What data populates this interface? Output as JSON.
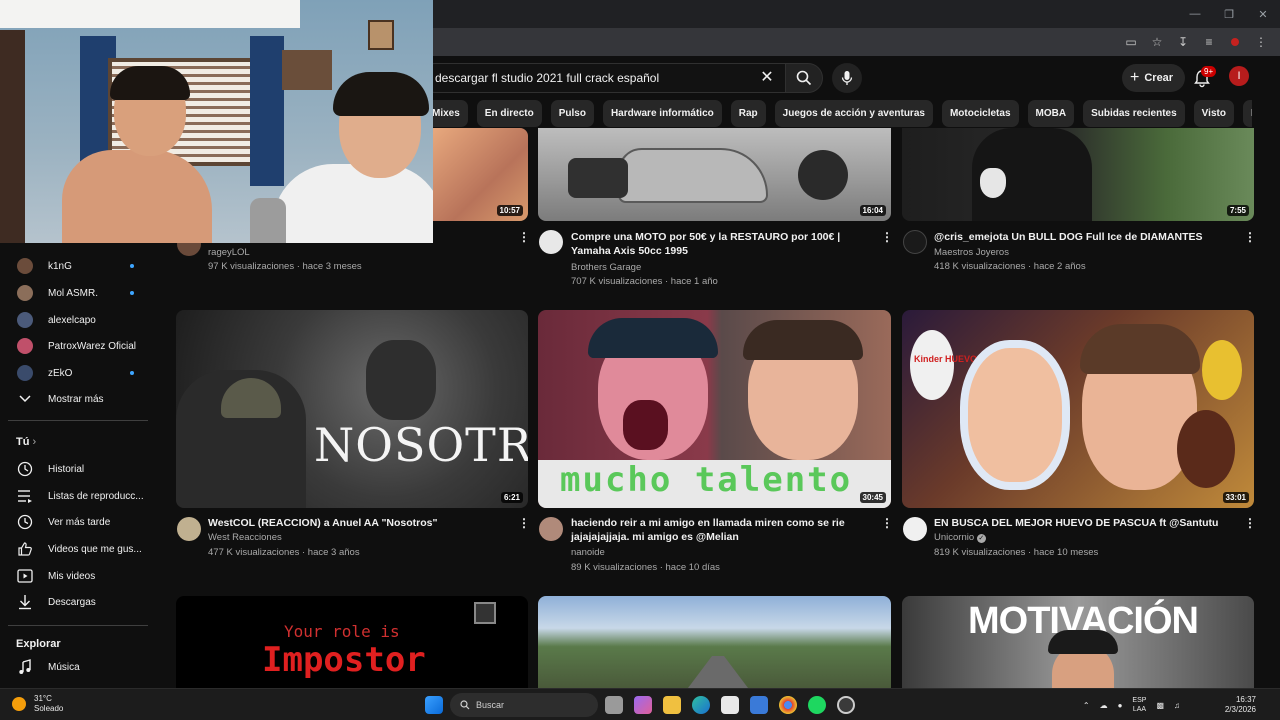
{
  "search": {
    "query": "descargar fl studio 2021 full crack español"
  },
  "header": {
    "create_label": "Crear",
    "notif_badge": "9+",
    "avatar_letter": "I"
  },
  "chips": [
    "Mixes",
    "En directo",
    "Pulso",
    "Hardware informático",
    "Rap",
    "Juegos de acción y aventuras",
    "Motocicletas",
    "MOBA",
    "Subidas recientes",
    "Visto",
    "Novedad para ti"
  ],
  "sidebar": {
    "subscriptions": [
      {
        "label": "k1nG",
        "color": "#6b4c3b"
      },
      {
        "label": "Mol ASMR.",
        "color": "#8b6e5a"
      },
      {
        "label": "alexelcapo",
        "color": "#4b5a7a"
      },
      {
        "label": "PatroxWarez Oficial",
        "color": "#c0506a"
      },
      {
        "label": "zEkO",
        "color": "#3a4b6b"
      }
    ],
    "show_more": "Mostrar más",
    "you_heading": "Tú",
    "you_items": [
      "Historial",
      "Listas de reproducc...",
      "Ver más tarde",
      "Videos que me gus...",
      "Mis videos",
      "Descargas"
    ],
    "explore_heading": "Explorar",
    "explore_items": [
      "Música"
    ]
  },
  "videos_row1": [
    {
      "title": "",
      "channel": "rageyLOL",
      "meta": "97 K visualizaciones · hace 3 meses",
      "duration": "10:57"
    },
    {
      "title": "Compre una MOTO por 50€ y la RESTAURO por 100€ | Yamaha Axis 50cc 1995",
      "channel": "Brothers Garage",
      "meta": "707 K visualizaciones · hace 1 año",
      "duration": "16:04"
    },
    {
      "title": "@cris_emejota  Un BULL DOG Full Ice de DIAMANTES",
      "channel": "Maestros Joyeros",
      "meta": "418 K visualizaciones · hace 2 años",
      "duration": "7:55"
    }
  ],
  "videos_row2": [
    {
      "title": "WestCOL (REACCION) a Anuel AA \"Nosotros\"",
      "channel": "West Reacciones",
      "meta": "477 K visualizaciones · hace 3 años",
      "duration": "6:21",
      "thumb_text": "NOSOTROS"
    },
    {
      "title": "haciendo reir a mi amigo en llamada miren como se rie jajajajajjaja. mi amigo es @Melian",
      "channel": "nanoide",
      "meta": "89 K visualizaciones · hace 10 días",
      "duration": "30:45",
      "thumb_text": "mucho talento"
    },
    {
      "title": "EN BUSCA DEL MEJOR HUEVO DE PASCUA ft  @Santutu",
      "channel": "Unicornio",
      "meta": "819 K visualizaciones · hace 10 meses",
      "duration": "33:01",
      "thumb_text": "Kinder HUEVO"
    }
  ],
  "videos_row3": [
    {
      "thumb_text_1": "Your role is",
      "thumb_text_2": "Impostor"
    },
    {},
    {
      "thumb_text": "MOTIVACIÓN"
    }
  ],
  "taskbar": {
    "temp": "31°C",
    "weather": "Soleado",
    "search_label": "Buscar",
    "lang_1": "ESP",
    "lang_2": "LAA",
    "time": "16:37",
    "date": "2/3/2026"
  }
}
